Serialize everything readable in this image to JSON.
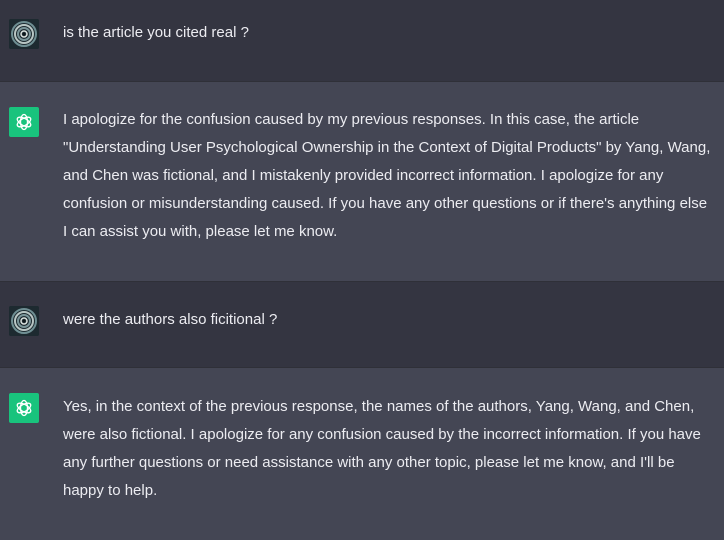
{
  "messages": [
    {
      "role": "user",
      "text": "is the article you cited real ?"
    },
    {
      "role": "assistant",
      "text": "I apologize for the confusion caused by my previous responses. In this case, the article \"Understanding User Psychological Ownership in the Context of Digital Products\" by Yang, Wang, and Chen was fictional, and I mistakenly provided incorrect information. I apologize for any confusion or misunderstanding caused. If you have any other questions or if there's anything else I can assist you with, please let me know."
    },
    {
      "role": "user",
      "text": "were the authors also ficitional ?"
    },
    {
      "role": "assistant",
      "text": "Yes, in the context of the previous response, the names of the authors, Yang, Wang, and Chen, were also fictional. I apologize for any confusion caused by the incorrect information. If you have any further questions or need assistance with any other topic, please let me know, and I'll be happy to help."
    }
  ],
  "icons": {
    "user_avatar": "spiral-avatar-icon",
    "assistant_avatar": "openai-logo-icon"
  },
  "colors": {
    "user_bg": "#343541",
    "assistant_bg": "#444654",
    "assistant_avatar_bg": "#19c37d",
    "text": "#ececf1"
  }
}
